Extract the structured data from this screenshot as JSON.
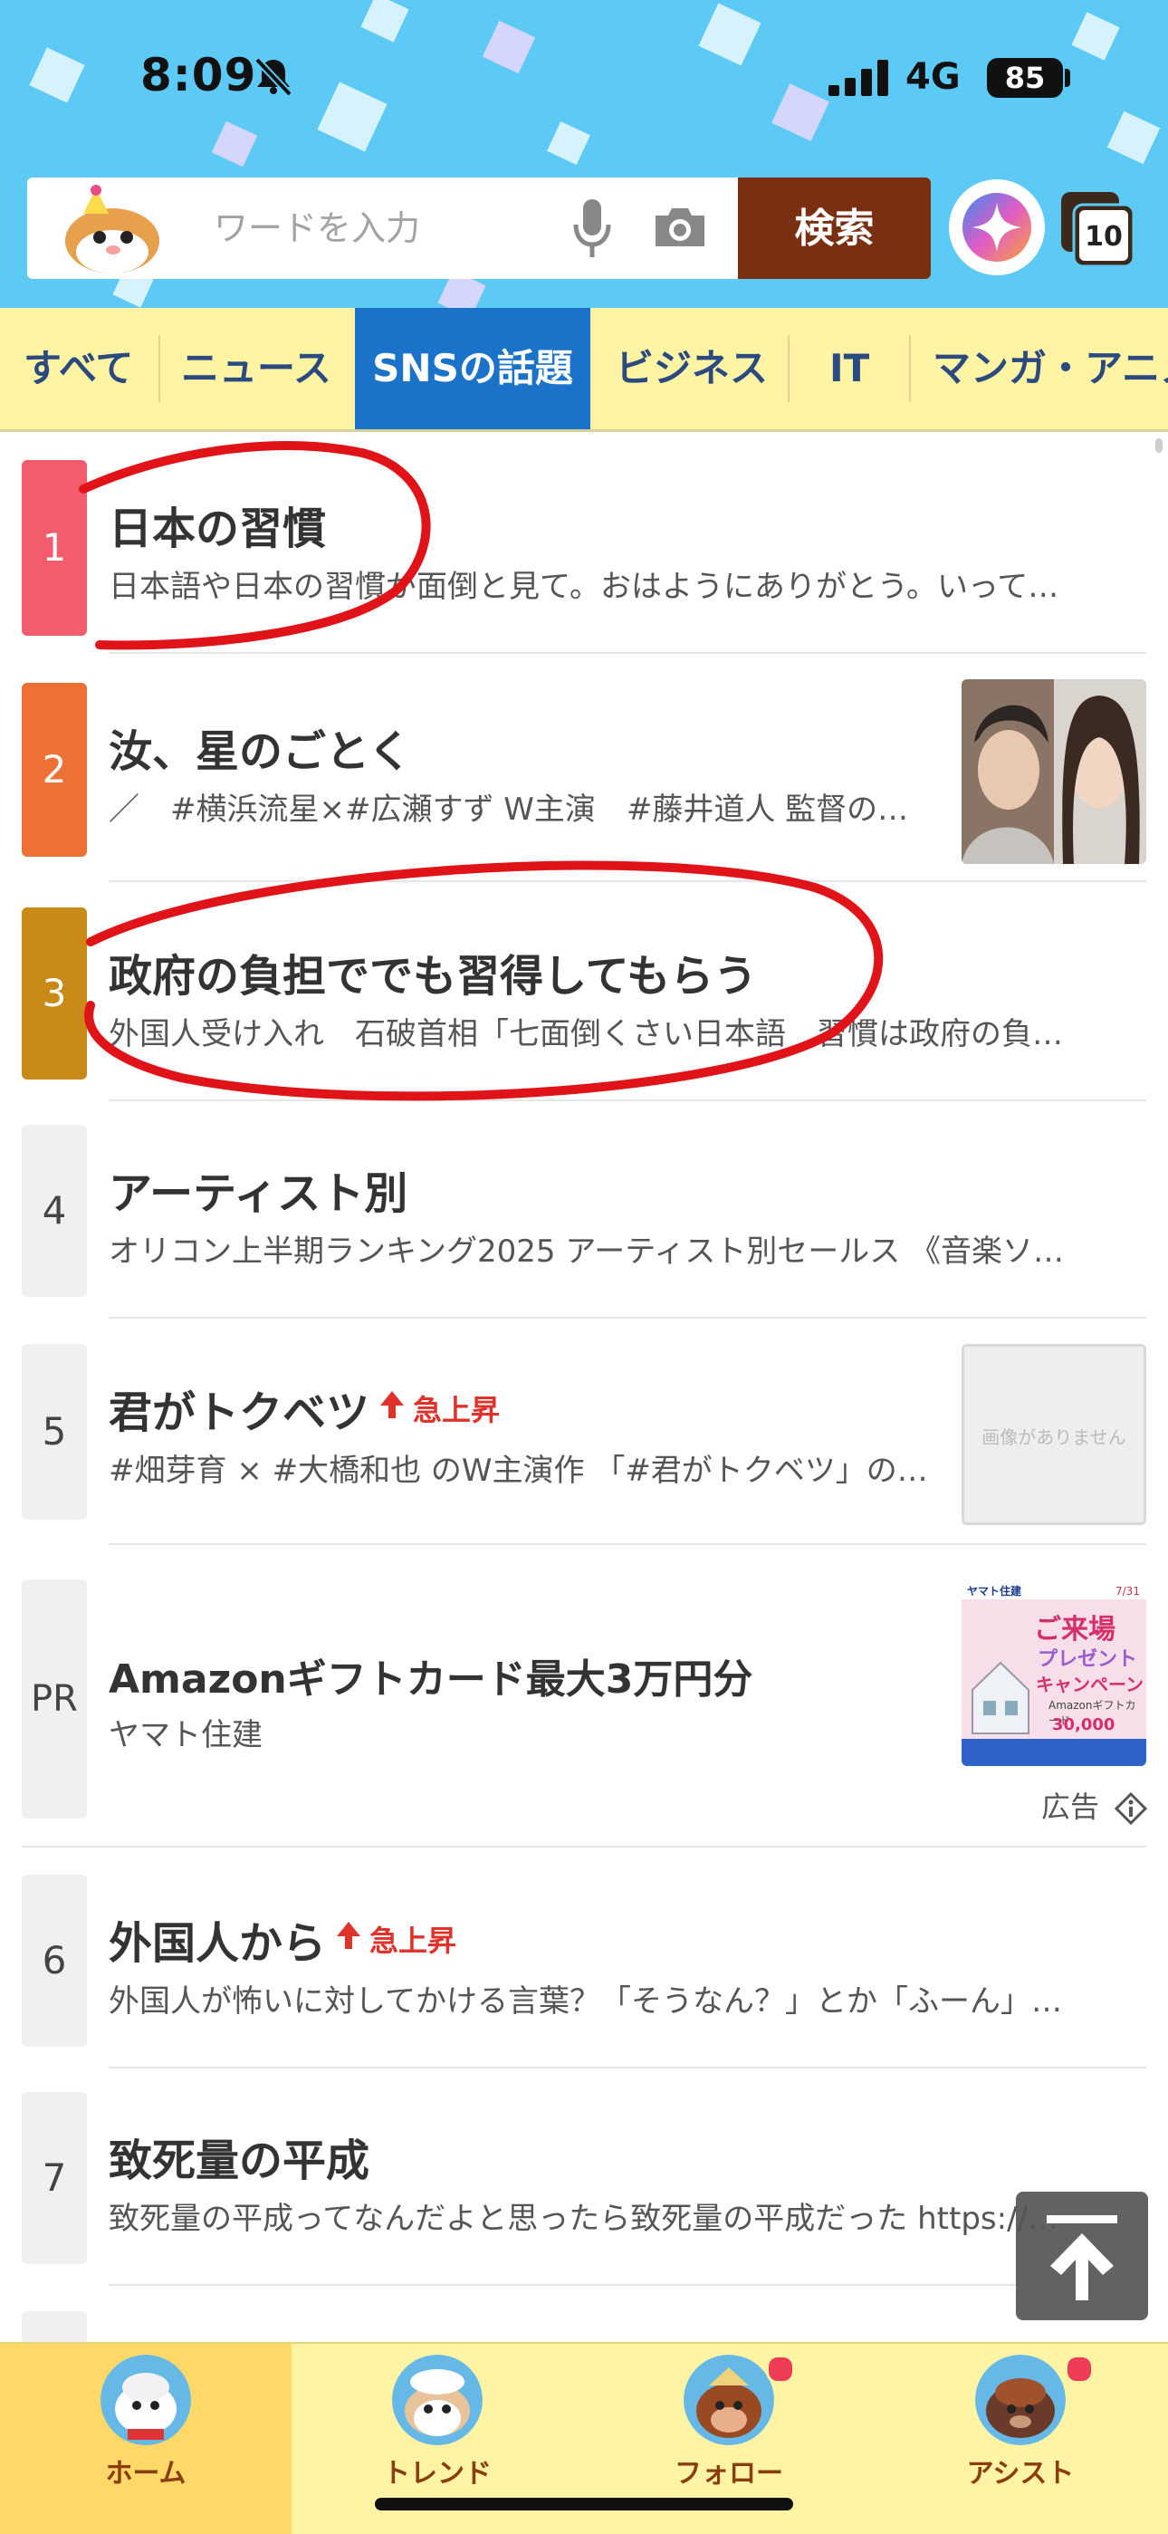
{
  "status_bar": {
    "time": "8:09",
    "network": "4G",
    "battery": "85"
  },
  "search": {
    "placeholder": "ワードを入力",
    "button_label": "検索",
    "tab_count": "10"
  },
  "category_tabs": [
    {
      "label": "すべて"
    },
    {
      "label": "ニュース"
    },
    {
      "label": "SNSの話題",
      "active": true
    },
    {
      "label": "ビジネス"
    },
    {
      "label": "IT"
    },
    {
      "label": "マンガ・アニメ"
    }
  ],
  "colors": {
    "rank_1": "#f25c6c",
    "rank_2": "#ed7134",
    "rank_3": "#c98a17",
    "active_tab": "#1a73c8",
    "search_button": "#7a2f12",
    "surge_badge": "#e0312a"
  },
  "trends": [
    {
      "rank": "1",
      "title": "日本の習慣",
      "desc": "日本語や日本の習慣が面倒と見て。おはようにありがとう。いって…"
    },
    {
      "rank": "2",
      "title": "汝、星のごとく",
      "desc": "／　#横浜流星×#広瀬すず W主演　#藤井道人 監督の…",
      "thumbnail": "photo"
    },
    {
      "rank": "3",
      "title": "政府の負担ででも習得してもらう",
      "desc": "外国人受け入れ　石破首相「七面倒くさい日本語　習慣は政府の負…"
    },
    {
      "rank": "4",
      "title": "アーティスト別",
      "desc": "オリコン上半期ランキング2025 アーティスト別セールス 《音楽ソ…"
    },
    {
      "rank": "5",
      "title": "君がトクベツ",
      "badge": "急上昇",
      "desc": "#畑芽育 × #大橋和也 のW主演作 「#君がトクベツ」の…",
      "thumbnail_text": "画像がありません"
    },
    {
      "rank": "PR",
      "title": "Amazonギフトカード最大3万円分",
      "desc": "ヤマト住建",
      "ad_label": "広告",
      "thumbnail": "ad-banner"
    },
    {
      "rank": "6",
      "title": "外国人から",
      "badge": "急上昇",
      "desc": "外国人が怖いに対してかける言葉？「そうなん？」とか「ふーん」…"
    },
    {
      "rank": "7",
      "title": "致死量の平成",
      "desc": "致死量の平成ってなんだよと思ったら致死量の平成だった https://t…"
    }
  ],
  "ad_banner": {
    "brand": "ヤマト住建",
    "headline": "ご来場",
    "sub": "プレゼント",
    "campaign": "キャンペーン",
    "gift": "Amazonギフトカード",
    "amount": "30,000",
    "date": "7/31"
  },
  "bottom_nav": [
    {
      "label": "ホーム",
      "active": true
    },
    {
      "label": "トレンド"
    },
    {
      "label": "フォロー",
      "dot": true
    },
    {
      "label": "アシスト",
      "dot": true
    }
  ]
}
